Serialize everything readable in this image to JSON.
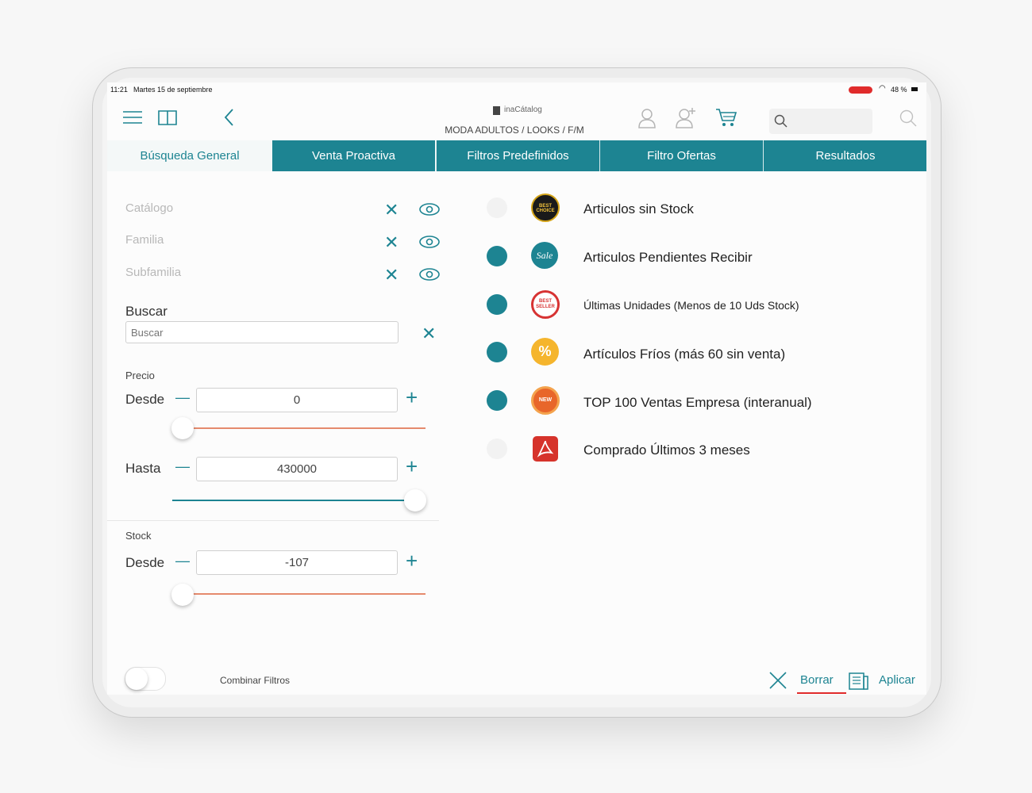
{
  "status": {
    "time": "11:21",
    "date": "Martes 15 de septiembre",
    "battery": "48 %"
  },
  "header": {
    "logo": "inaCátalog",
    "breadcrumb": "MODA ADULTOS / LOOKS / F/M"
  },
  "tabs": [
    {
      "label": "Búsqueda General"
    },
    {
      "label": "Venta Proactiva"
    },
    {
      "label": "Filtros Predefinidos"
    },
    {
      "label": "Filtro Ofertas"
    },
    {
      "label": "Resultados"
    }
  ],
  "filters": {
    "catalogo": "Catálogo",
    "familia": "Familia",
    "subfamilia": "Subfamilia"
  },
  "buscar": {
    "label": "Buscar",
    "placeholder": "Buscar"
  },
  "precio": {
    "section": "Precio",
    "desde_label": "Desde",
    "desde_value": "0",
    "hasta_label": "Hasta",
    "hasta_value": "430000"
  },
  "stock": {
    "section": "Stock",
    "desde_label": "Desde",
    "desde_value": "-107"
  },
  "predef": [
    {
      "label": "Articulos sin Stock",
      "active": false
    },
    {
      "label": "Articulos Pendientes Recibir",
      "active": true
    },
    {
      "label": "Últimas Unidades (Menos de 10 Uds Stock)",
      "active": true
    },
    {
      "label": "Artículos Fríos (más 60 sin venta)",
      "active": true
    },
    {
      "label": "TOP 100 Ventas Empresa (interanual)",
      "active": true
    },
    {
      "label": "Comprado Últimos 3 meses",
      "active": false
    }
  ],
  "badges": {
    "b0": "BEST CHOICE",
    "b1": "Sale",
    "b2": "BEST SELLER",
    "b3": "%",
    "b4": "NEW"
  },
  "footer": {
    "combinar": "Combinar Filtros",
    "borrar": "Borrar",
    "aplicar": "Aplicar"
  },
  "colors": {
    "accent": "#1d8492",
    "slider_fill": "#e58a6d"
  }
}
